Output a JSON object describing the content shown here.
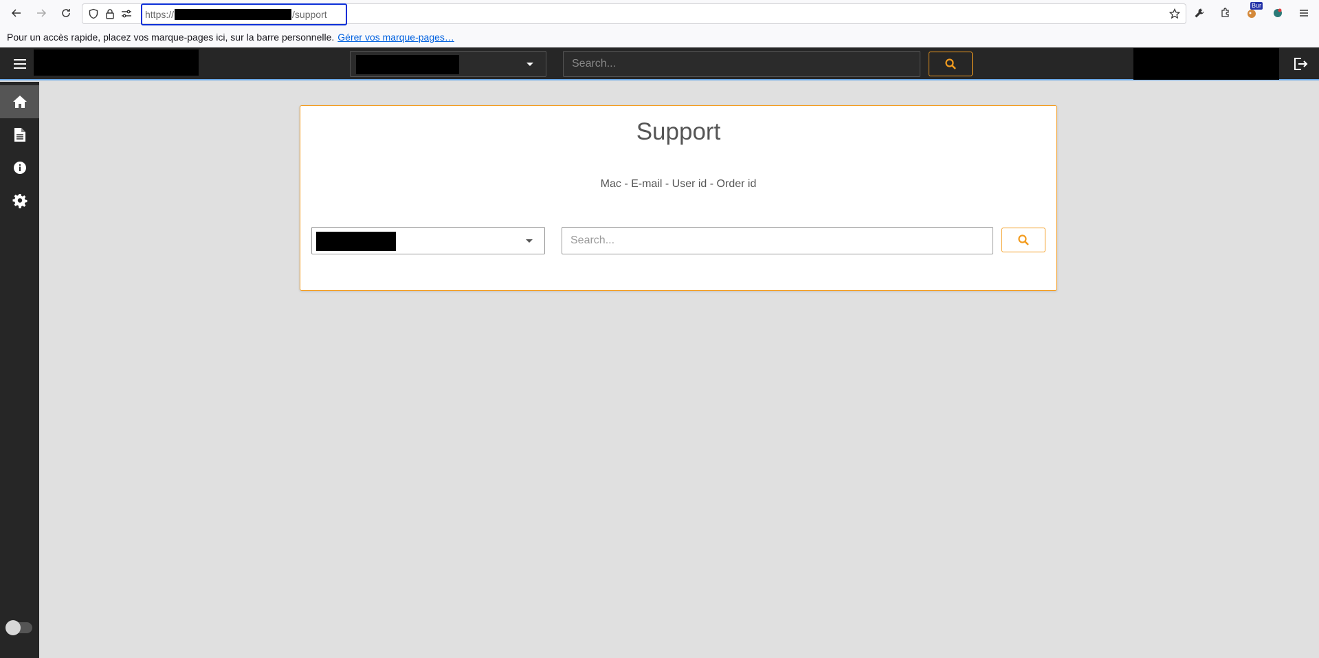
{
  "browser": {
    "url_prefix": "https://",
    "url_suffix": "/support",
    "addon_badge": "Bur"
  },
  "bookmarks_bar": {
    "message": "Pour un accès rapide, placez vos marque-pages ici, sur la barre personnelle.",
    "link": "Gérer vos marque-pages…"
  },
  "header": {
    "search_placeholder": "Search..."
  },
  "sidebar": {
    "items": [
      {
        "icon": "home-icon",
        "active": true
      },
      {
        "icon": "document-icon",
        "active": false
      },
      {
        "icon": "info-icon",
        "active": false
      },
      {
        "icon": "gear-icon",
        "active": false
      }
    ]
  },
  "support": {
    "title": "Support",
    "subtitle": "Mac - E-mail - User id - Order id",
    "search_placeholder": "Search..."
  },
  "colors": {
    "accent": "#f39c1f",
    "header_bg": "#262626",
    "page_bg": "#e0e0e0"
  }
}
